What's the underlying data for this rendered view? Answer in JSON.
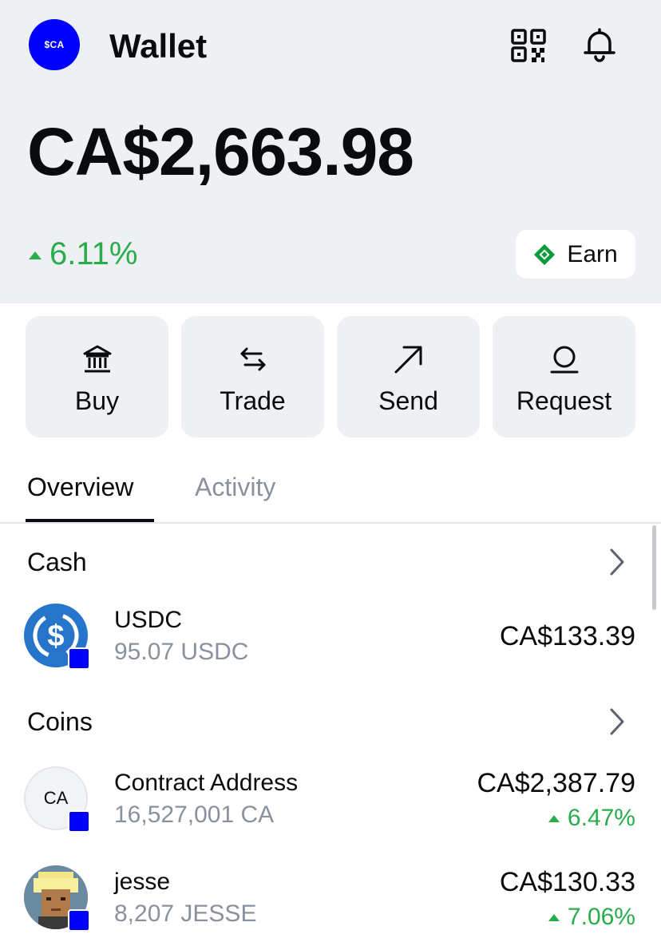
{
  "header": {
    "avatar_label": "$CA",
    "title": "Wallet",
    "qr_icon": "qr-code-icon",
    "bell_icon": "bell-icon"
  },
  "balance": {
    "amount": "CA$2,663.98",
    "change": "6.11%",
    "change_direction": "up"
  },
  "earn": {
    "label": "Earn",
    "icon": "diamond-icon"
  },
  "actions": [
    {
      "label": "Buy",
      "icon": "bank-icon"
    },
    {
      "label": "Trade",
      "icon": "swap-arrows-icon"
    },
    {
      "label": "Send",
      "icon": "arrow-up-right-icon"
    },
    {
      "label": "Request",
      "icon": "receive-icon"
    }
  ],
  "tabs": [
    {
      "label": "Overview",
      "active": true
    },
    {
      "label": "Activity",
      "active": false
    }
  ],
  "cash": {
    "title": "Cash",
    "items": [
      {
        "name": "USDC",
        "amount": "95.07 USDC",
        "value": "CA$133.39",
        "icon": "usdc-icon"
      }
    ]
  },
  "coins": {
    "title": "Coins",
    "items": [
      {
        "name": "Contract Address",
        "icon_text": "CA",
        "amount": "16,527,001 CA",
        "value": "CA$2,387.79",
        "change": "6.47%"
      },
      {
        "name": "jesse",
        "amount": "8,207 JESSE",
        "value": "CA$130.33",
        "change": "7.06%",
        "icon": "pixel-avatar-icon"
      }
    ]
  },
  "colors": {
    "brand": "#0000ff",
    "positive": "#27ad4a",
    "background": "#eef0f3",
    "usdc": "#2775ca"
  }
}
